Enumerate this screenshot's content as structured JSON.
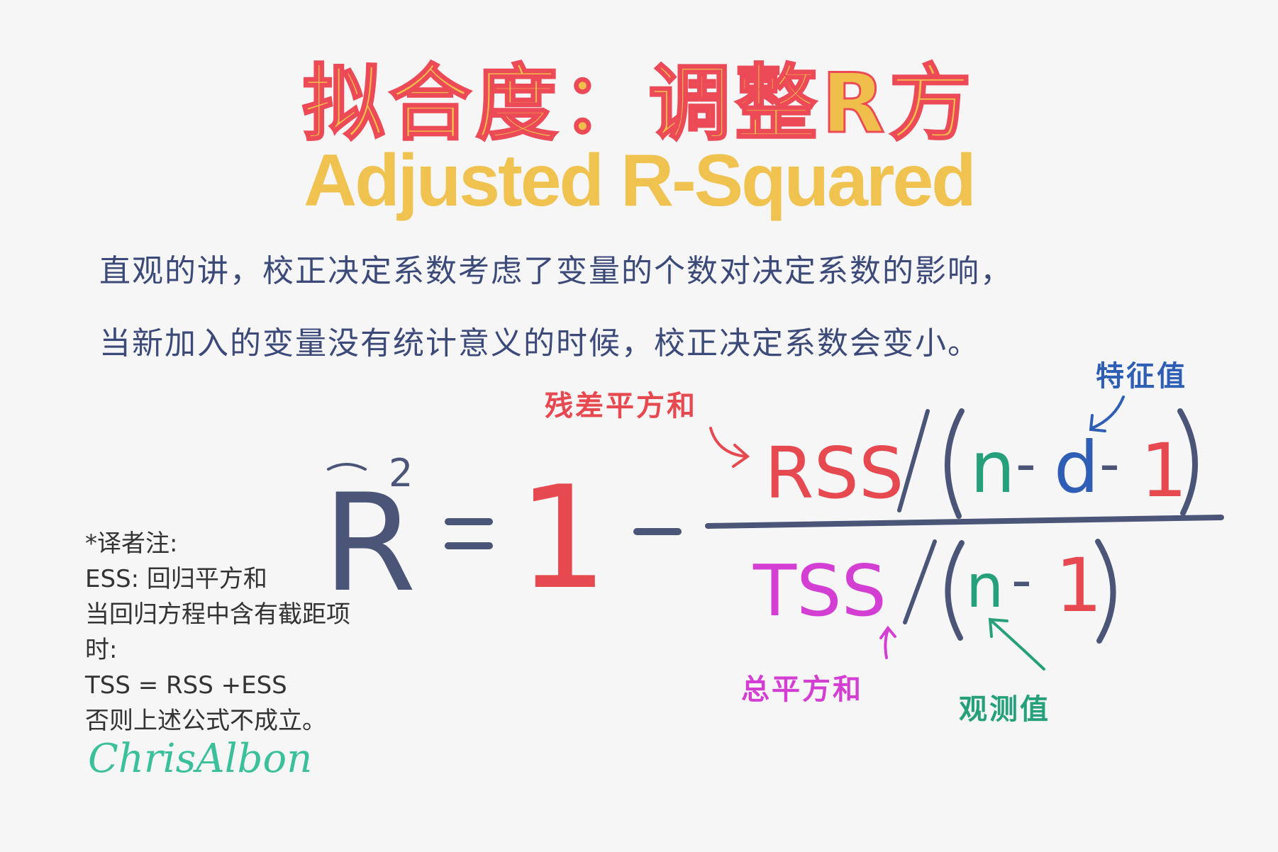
{
  "title": {
    "cn": "拟合度：调整R方",
    "en": "Adjusted R-Squared"
  },
  "intro": {
    "line1": "直观的讲，校正决定系数考虑了变量的个数对决定系数的影响，",
    "line2": "当新加入的变量没有统计意义的时候，校正决定系数会变小。"
  },
  "formula": {
    "lhs_symbol": "R",
    "exponent": "2",
    "equals": "=",
    "one": "1",
    "minus": "−",
    "numerator": {
      "rss": "RSS",
      "slash": "/",
      "n": "n",
      "minus1": "-",
      "d": "d",
      "minus2": "-",
      "one": "1"
    },
    "denominator": {
      "tss": "TSS",
      "slash": "/",
      "n": "n",
      "minus": "-",
      "one": "1"
    }
  },
  "labels": {
    "rss": "残差平方和",
    "feature": "特征值",
    "tss": "总平方和",
    "observed": "观测值"
  },
  "note": {
    "line1": "*译者注:",
    "line2": "ESS: 回归平方和",
    "line3": "当回归方程中含有截距项",
    "line4": "时:",
    "line5": "TSS = RSS +ESS",
    "line6": "否则上述公式不成立。"
  },
  "signature": "ChrisAlbon",
  "colors": {
    "title_fill": "#f0be4a",
    "title_stroke": "#ec4a57",
    "rss": "#e6494f",
    "feature": "#2f5fb5",
    "tss": "#d43fd3",
    "observed": "#26a07a",
    "formula_dark": "#4b5577"
  }
}
